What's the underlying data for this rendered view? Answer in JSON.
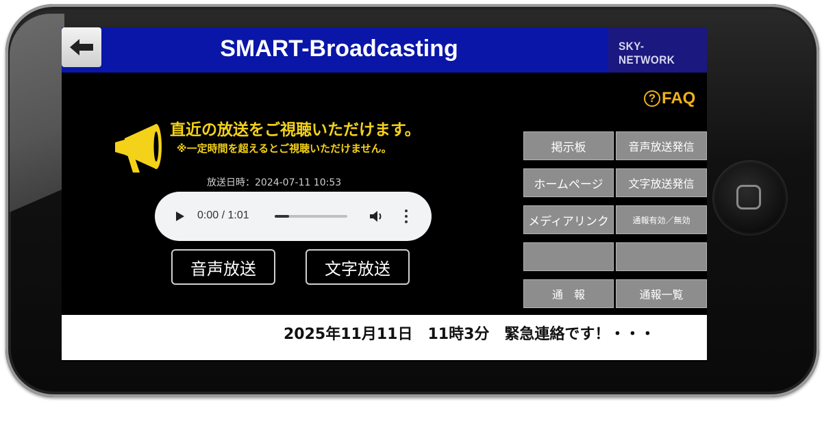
{
  "header": {
    "title": "SMART-Broadcasting",
    "brand": "SKY-NETWORK"
  },
  "faq": {
    "icon": "question-circle-icon",
    "label": "FAQ"
  },
  "notice": {
    "headline": "直近の放送をご視聴いただけます。",
    "note": "※一定時間を超えるとご視聴いただけません。"
  },
  "broadcast": {
    "datetime": "放送日時：2024-07-11 10:53"
  },
  "audio": {
    "time": "0:00 / 1:01",
    "progress": 0.2
  },
  "modes": {
    "audio_label": "音声放送",
    "text_label": "文字放送"
  },
  "menu": {
    "bulletin": "掲示板",
    "audio_send": "音声放送発信",
    "homepage": "ホームページ",
    "text_send": "文字放送発信",
    "media_link": "メディアリンク",
    "alert_toggle": "通報有効／無効",
    "empty_1": "",
    "empty_2": "",
    "report": "通　報",
    "report_list": "通報一覧"
  },
  "ticker": {
    "message": "2025年11月11日　11時3分　緊急連絡です！・・・"
  },
  "colors": {
    "header_bg": "#0a16a8",
    "brand_bg": "#1b1880",
    "accent_yellow": "#f4d21a",
    "faq_orange": "#f2b21a",
    "menu_gray": "#8d8d8d"
  }
}
